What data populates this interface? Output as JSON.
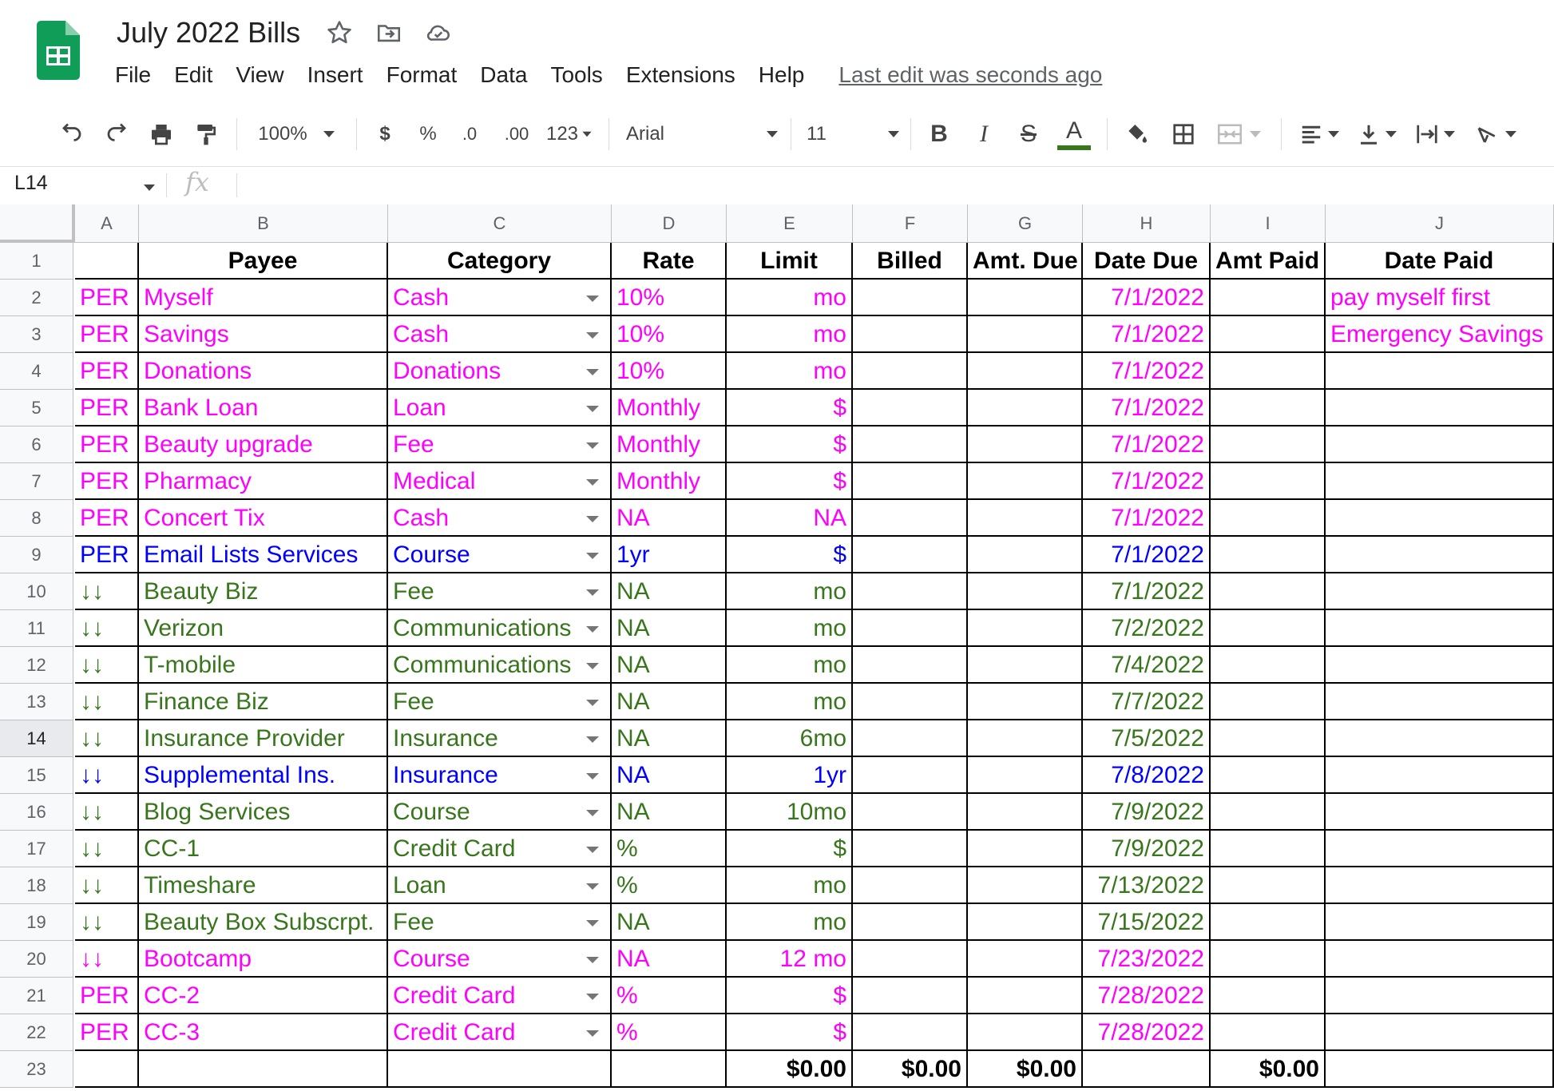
{
  "doc": {
    "title": "July 2022 Bills",
    "last_edit": "Last edit was seconds ago",
    "menu": [
      "File",
      "Edit",
      "View",
      "Insert",
      "Format",
      "Data",
      "Tools",
      "Extensions",
      "Help"
    ]
  },
  "toolbar": {
    "zoom": "100%",
    "currency": "$",
    "percent": "%",
    "dec_decrease": ".0",
    "dec_increase": ".00",
    "more_formats": "123",
    "font": "Arial",
    "font_size": "11",
    "bold": "B",
    "italic": "I",
    "strike": "S",
    "text_color": "A"
  },
  "formula_bar": {
    "cell_ref": "L14",
    "fx": "fx"
  },
  "colors": {
    "pink": "#ff00ff",
    "blue": "#0000ff",
    "green": "#38761d",
    "brand_green": "#0f9d58"
  },
  "columns": [
    "A",
    "B",
    "C",
    "D",
    "E",
    "F",
    "G",
    "H",
    "I",
    "J"
  ],
  "row_numbers": [
    "1",
    "2",
    "3",
    "4",
    "5",
    "6",
    "7",
    "8",
    "9",
    "10",
    "11",
    "12",
    "13",
    "14",
    "15",
    "16",
    "17",
    "18",
    "19",
    "20",
    "21",
    "22",
    "23"
  ],
  "header": [
    "",
    "Payee",
    "Category",
    "Rate",
    "Limit",
    "Billed",
    "Amt. Due",
    "Date Due",
    "Amt Paid",
    "Date Paid"
  ],
  "rows": [
    {
      "color": "pink",
      "cells": [
        "PER",
        "Myself",
        "Cash",
        "10%",
        "mo",
        "",
        "",
        "7/1/2022",
        "",
        "pay myself first"
      ]
    },
    {
      "color": "pink",
      "cells": [
        "PER",
        "Savings",
        "Cash",
        "10%",
        "mo",
        "",
        "",
        "7/1/2022",
        "",
        "Emergency Savings"
      ]
    },
    {
      "color": "pink",
      "cells": [
        "PER",
        "Donations",
        "Donations",
        "10%",
        "mo",
        "",
        "",
        "7/1/2022",
        "",
        ""
      ]
    },
    {
      "color": "pink",
      "cells": [
        "PER",
        "Bank Loan",
        "Loan",
        "Monthly",
        "$",
        "",
        "",
        "7/1/2022",
        "",
        ""
      ]
    },
    {
      "color": "pink",
      "cells": [
        "PER",
        "Beauty upgrade",
        "Fee",
        "Monthly",
        "$",
        "",
        "",
        "7/1/2022",
        "",
        ""
      ]
    },
    {
      "color": "pink",
      "cells": [
        "PER",
        "Pharmacy",
        "Medical",
        "Monthly",
        "$",
        "",
        "",
        "7/1/2022",
        "",
        ""
      ]
    },
    {
      "color": "pink",
      "cells": [
        "PER",
        "Concert Tix",
        "Cash",
        "NA",
        "NA",
        "",
        "",
        "7/1/2022",
        "",
        ""
      ]
    },
    {
      "color": "blue",
      "cells": [
        "PER",
        "Email Lists Services",
        "Course",
        "1yr",
        "$",
        "",
        "",
        "7/1/2022",
        "",
        ""
      ]
    },
    {
      "color": "green",
      "cells": [
        "↓↓",
        "Beauty Biz",
        "Fee",
        "NA",
        "mo",
        "",
        "",
        "7/1/2022",
        "",
        ""
      ]
    },
    {
      "color": "green",
      "cells": [
        "↓↓",
        "Verizon",
        "Communications",
        "NA",
        "mo",
        "",
        "",
        "7/2/2022",
        "",
        ""
      ]
    },
    {
      "color": "green",
      "cells": [
        "↓↓",
        "T-mobile",
        "Communications",
        "NA",
        "mo",
        "",
        "",
        "7/4/2022",
        "",
        ""
      ]
    },
    {
      "color": "green",
      "cells": [
        "↓↓",
        "Finance Biz",
        "Fee",
        "NA",
        "mo",
        "",
        "",
        "7/7/2022",
        "",
        ""
      ]
    },
    {
      "color": "green",
      "cells": [
        "↓↓",
        "Insurance Provider",
        "Insurance",
        "NA",
        "6mo",
        "",
        "",
        "7/5/2022",
        "",
        ""
      ]
    },
    {
      "color": "blue",
      "cells": [
        "↓↓",
        "Supplemental Ins.",
        "Insurance",
        "NA",
        "1yr",
        "",
        "",
        "7/8/2022",
        "",
        ""
      ]
    },
    {
      "color": "green",
      "cells": [
        "↓↓",
        "Blog Services",
        "Course",
        "NA",
        "10mo",
        "",
        "",
        "7/9/2022",
        "",
        ""
      ]
    },
    {
      "color": "green",
      "cells": [
        "↓↓",
        "CC-1",
        "Credit Card",
        "%",
        "$",
        "",
        "",
        "7/9/2022",
        "",
        ""
      ]
    },
    {
      "color": "green",
      "cells": [
        "↓↓",
        "Timeshare",
        "Loan",
        "%",
        "mo",
        "",
        "",
        "7/13/2022",
        "",
        ""
      ]
    },
    {
      "color": "green",
      "cells": [
        "↓↓",
        "Beauty Box Subscrpt.",
        "Fee",
        "NA",
        "mo",
        "",
        "",
        "7/15/2022",
        "",
        ""
      ]
    },
    {
      "color": "pink",
      "cells": [
        "↓↓",
        "Bootcamp",
        "Course",
        "NA",
        "12 mo",
        "",
        "",
        "7/23/2022",
        "",
        ""
      ]
    },
    {
      "color": "pink",
      "cells": [
        "PER",
        "CC-2",
        "Credit Card",
        "%",
        "$",
        "",
        "",
        "7/28/2022",
        "",
        ""
      ]
    },
    {
      "color": "pink",
      "cells": [
        "PER",
        "CC-3",
        "Credit Card",
        "%",
        "$",
        "",
        "",
        "7/28/2022",
        "",
        ""
      ]
    }
  ],
  "totals": [
    "",
    "",
    "",
    "",
    "$0.00",
    "$0.00",
    "$0.00",
    "",
    "$0.00",
    ""
  ]
}
